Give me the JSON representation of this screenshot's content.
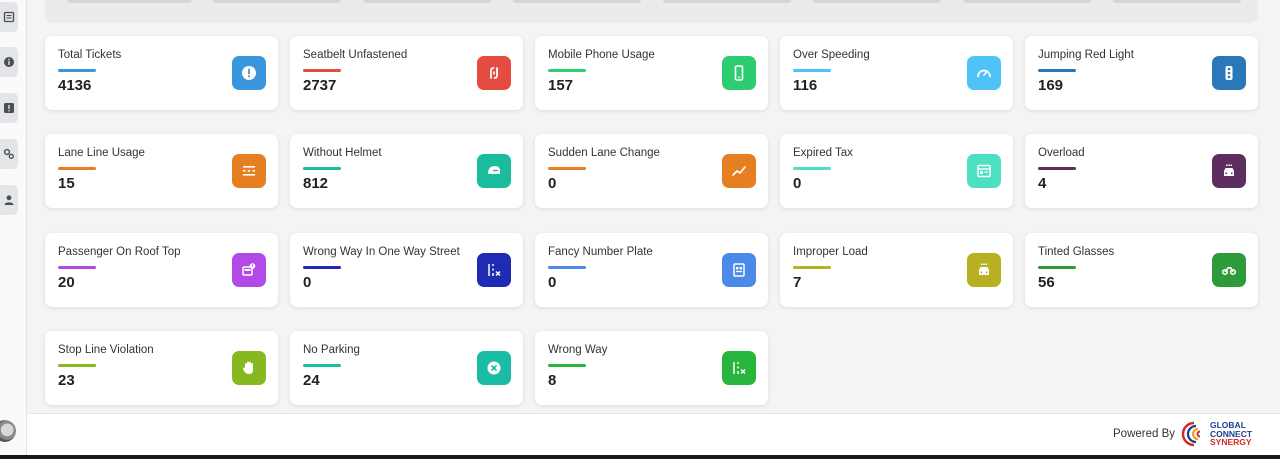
{
  "sidebar": {
    "items": [
      {
        "icon": "list-icon"
      },
      {
        "icon": "info-icon"
      },
      {
        "icon": "alert-box-icon"
      },
      {
        "icon": "settings-group-icon"
      },
      {
        "icon": "user-icon"
      }
    ]
  },
  "cards": [
    {
      "label": "Total Tickets",
      "value": "4136",
      "color": "#3b97dd",
      "icon": "alert-circle-icon"
    },
    {
      "label": "Seatbelt Unfastened",
      "value": "2737",
      "color": "#e44c41",
      "icon": "seatbelt-icon"
    },
    {
      "label": "Mobile Phone Usage",
      "value": "157",
      "color": "#2ecc71",
      "icon": "mobile-phone-icon"
    },
    {
      "label": "Over Speeding",
      "value": "116",
      "color": "#4fc3f7",
      "icon": "speedometer-icon"
    },
    {
      "label": "Jumping Red Light",
      "value": "169",
      "color": "#2a78b9",
      "icon": "traffic-light-icon"
    },
    {
      "label": "Lane Line Usage",
      "value": "15",
      "color": "#e67e22",
      "icon": "lane-lines-icon"
    },
    {
      "label": "Without Helmet",
      "value": "812",
      "color": "#1abc9c",
      "icon": "helmet-icon"
    },
    {
      "label": "Sudden Lane Change",
      "value": "0",
      "color": "#e67e22",
      "icon": "trend-up-icon"
    },
    {
      "label": "Expired Tax",
      "value": "0",
      "color": "#4ce0c0",
      "icon": "tax-document-icon"
    },
    {
      "label": "Overload",
      "value": "4",
      "color": "#5e2d5f",
      "icon": "overloaded-car-icon"
    },
    {
      "label": "Passenger On Roof Top",
      "value": "20",
      "color": "#b24ae8",
      "icon": "bus-roof-icon"
    },
    {
      "label": "Wrong Way In One Way Street",
      "value": "0",
      "color": "#1f2bb3",
      "icon": "wrong-way-street-icon"
    },
    {
      "label": "Fancy Number Plate",
      "value": "0",
      "color": "#4a8ae8",
      "icon": "number-plate-icon"
    },
    {
      "label": "Improper Load",
      "value": "7",
      "color": "#b7b021",
      "icon": "loaded-car-icon"
    },
    {
      "label": "Tinted Glasses",
      "value": "56",
      "color": "#2e9b3a",
      "icon": "tinted-car-icon"
    },
    {
      "label": "Stop Line Violation",
      "value": "23",
      "color": "#86b81f",
      "icon": "stop-hand-icon"
    },
    {
      "label": "No Parking",
      "value": "24",
      "color": "#1abca4",
      "icon": "no-parking-icon"
    },
    {
      "label": "Wrong Way",
      "value": "8",
      "color": "#27b53c",
      "icon": "wrong-way-icon"
    }
  ],
  "footer": {
    "powered_by": "Powered By",
    "logo": {
      "line1": "GLOBAL",
      "line2": "CONNECT",
      "line3": "SYNERGY"
    }
  }
}
